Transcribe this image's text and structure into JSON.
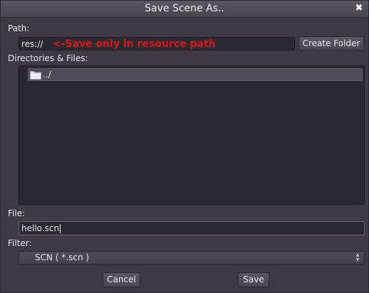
{
  "window": {
    "title": "Save Scene As..",
    "close_icon": "close-icon"
  },
  "path": {
    "label": "Path:",
    "value": "res://",
    "hint": "<-Save only in resource path",
    "hint_color": "#e01010",
    "create_folder_label": "Create Folder"
  },
  "directories": {
    "label": "Directories & Files:",
    "items": [
      {
        "label": "../",
        "icon": "folder-icon"
      }
    ]
  },
  "file": {
    "label": "File:",
    "value": "hello.scn"
  },
  "filter": {
    "label": "Filter:",
    "selected": "SCN ( *.scn )"
  },
  "actions": {
    "cancel_label": "Cancel",
    "save_label": "Save"
  }
}
